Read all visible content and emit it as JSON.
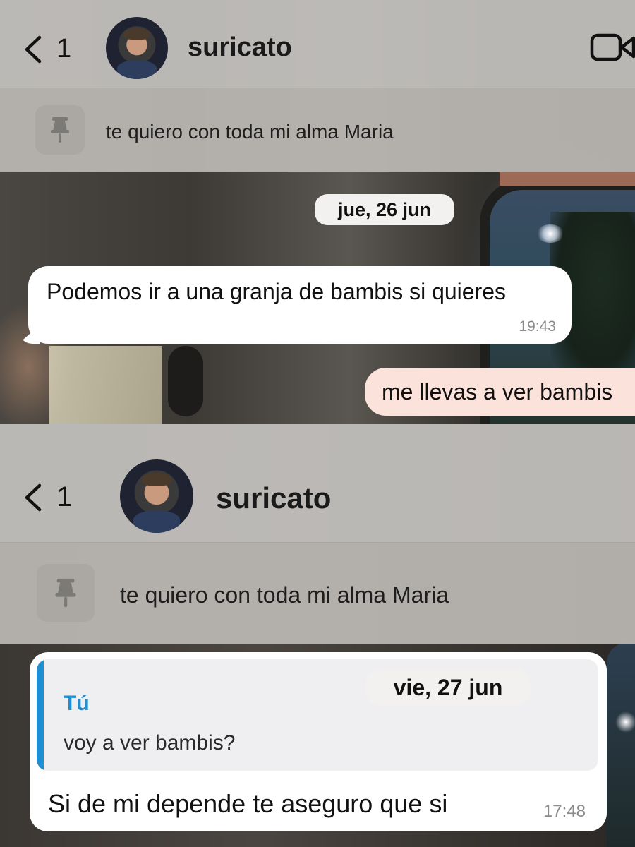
{
  "screens": [
    {
      "header": {
        "back_count": "1",
        "contact_name": "suricato",
        "video_icon": "video-camera-icon"
      },
      "pinned": {
        "icon": "pin-icon",
        "text": "te quiero con toda mi alma Maria"
      },
      "date_pill": "jue, 26 jun",
      "incoming": {
        "text": "Podemos ir a una granja de bambis si quieres",
        "time": "19:43"
      },
      "outgoing": {
        "text": "me llevas a ver bambis"
      }
    },
    {
      "header": {
        "back_count": "1",
        "contact_name": "suricato"
      },
      "pinned": {
        "icon": "pin-icon",
        "text": "te quiero con toda mi alma Maria"
      },
      "date_pill": "vie, 27 jun",
      "incoming": {
        "reply": {
          "author": "Tú",
          "text": "voy a ver bambis?"
        },
        "text": "Si de mi depende te aseguro que si",
        "time": "17:48"
      }
    }
  ],
  "colors": {
    "incoming_bubble": "#ffffff",
    "outgoing_bubble": "#fbe2da",
    "reply_accent": "#1f8fd4",
    "header_bg": "#c4c2be",
    "pinned_bg": "#bab7b2"
  }
}
